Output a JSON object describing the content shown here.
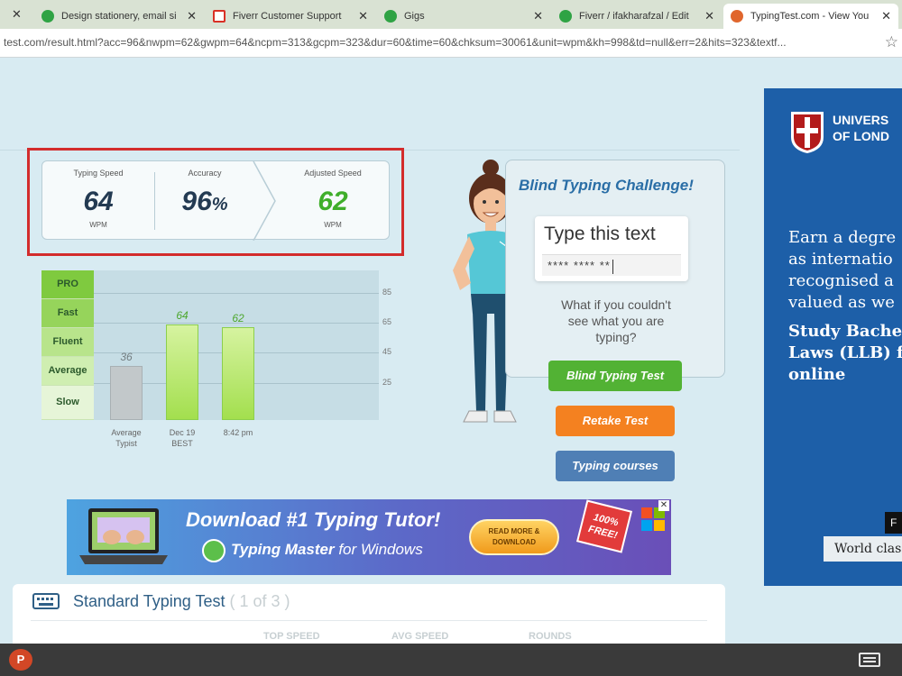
{
  "browser": {
    "tabs": [
      {
        "title": "Design stationery, email si",
        "close": "✕"
      },
      {
        "title": "Fiverr Customer Support",
        "close": "✕"
      },
      {
        "title": "Gigs",
        "close": "✕"
      },
      {
        "title": "Fiverr / ifakharafzal / Edit",
        "close": "✕"
      },
      {
        "title": "TypingTest.com - View You",
        "close": "✕"
      }
    ],
    "lead_close": "✕",
    "url": "test.com/result.html?acc=96&nwpm=62&gwpm=64&ncpm=313&gcpm=323&dur=60&time=60&chksum=30061&unit=wpm&kh=998&td=null&err=2&hits=323&textf...",
    "bookmark_icon": "star-icon"
  },
  "results": {
    "typing_speed": {
      "label": "Typing Speed",
      "value": "64",
      "unit": "WPM"
    },
    "accuracy": {
      "label": "Accuracy",
      "value": "96",
      "unit": "%"
    },
    "adjusted_speed": {
      "label": "Adjusted Speed",
      "value": "62",
      "unit": "WPM"
    },
    "highlight_color": "#d32c2c"
  },
  "chart_data": {
    "type": "bar",
    "categories": [
      "Average Typist",
      "Dec 19 BEST",
      "8:42 pm"
    ],
    "values": [
      36,
      64,
      62
    ],
    "data_labels": [
      "36",
      "64",
      "62"
    ],
    "y_ticks": [
      25,
      45,
      65,
      85
    ],
    "ylim": [
      0,
      100
    ],
    "scale_bands": [
      "PRO",
      "Fast",
      "Fluent",
      "Average",
      "Slow"
    ],
    "colors": {
      "average": "#c2c8ca",
      "user": "#a3df4e"
    },
    "grid": true
  },
  "chart_text": {
    "x_labels": [
      [
        "Average",
        "Typist"
      ],
      [
        "Dec 19",
        "BEST"
      ],
      [
        "8:42 pm",
        ""
      ]
    ]
  },
  "blind": {
    "title": "Blind Typing Challenge!",
    "prompt": "Type this text",
    "masked": "**** **** **",
    "question": "What if you couldn't see what you are typing?"
  },
  "buttons": {
    "blind": "Blind Typing Test",
    "retake": "Retake Test",
    "courses": "Typing courses"
  },
  "banner": {
    "title": "Download #1 Typing Tutor!",
    "sub_brand": "Typing Master",
    "sub_rest": " for Windows",
    "cta": "READ MORE & DOWNLOAD",
    "free": "100% FREE!",
    "close": "✕"
  },
  "standard": {
    "title": "Standard Typing Test",
    "sub": "( 1 of 3 )",
    "col1": "TOP SPEED",
    "col2": "AVG SPEED",
    "col3": "ROUNDS"
  },
  "side_ad": {
    "uni_line1": "UNIVERS",
    "uni_line2": "OF LOND",
    "text_lines": [
      "Earn a degre",
      "as internatio",
      "recognised a",
      "valued as we"
    ],
    "bold_lines": [
      "Study Bache",
      "Laws (LLB) f",
      "online"
    ],
    "tag": "World clas",
    "mini": "F"
  },
  "taskbar": {
    "ppt": "P"
  },
  "colors": {
    "brand_blue": "#2a6ea6",
    "green": "#52b234",
    "orange": "#f48120",
    "steel": "#4f7fb5"
  }
}
